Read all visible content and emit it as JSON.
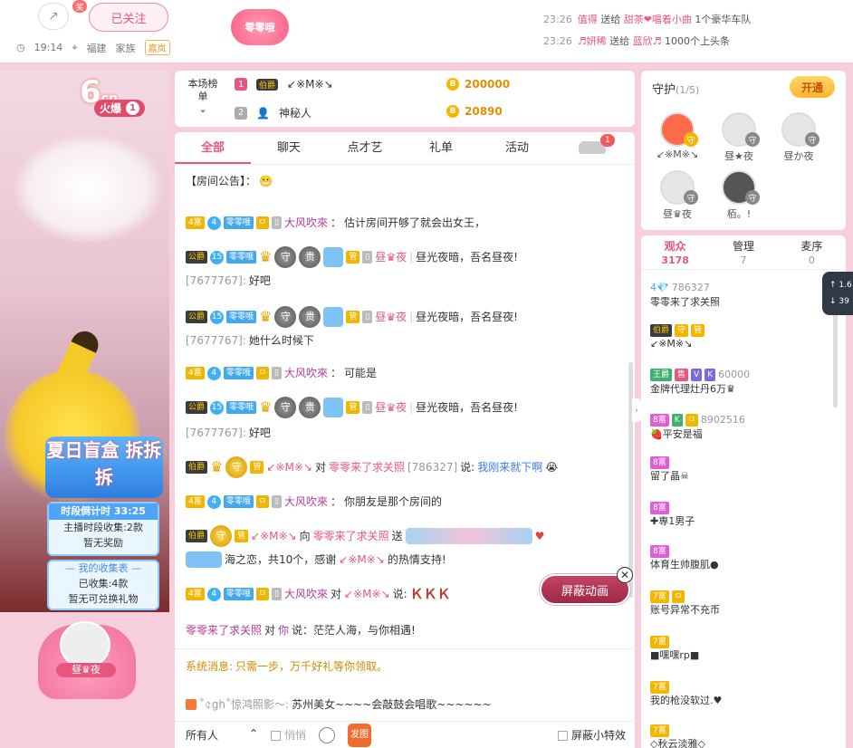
{
  "topbar": {
    "share_badge": "奖",
    "follow_label": "已关注",
    "time": "19:14",
    "location": "福建",
    "family_label": "家族",
    "family_tag": "嘉岚",
    "host_badge": "零零哦",
    "marquee": [
      {
        "time": "23:26",
        "text": "值得",
        "action": "送给",
        "target": "甜茶❤唱着小曲",
        "suffix": "1个豪华车队"
      },
      {
        "time": "23:26",
        "text": "♬妍稀",
        "action": "送给",
        "target": "蓝欣♬",
        "suffix": "1000个上头条"
      }
    ]
  },
  "video": {
    "logo": "6",
    "logo_sub": "cn",
    "hot_label": "火爆",
    "hot_num": "1",
    "box_title": "夏日盲盒 拆拆拆",
    "timer_title": "时段倒计时 33:25",
    "timer_line1": "主播时段收集:2款",
    "timer_line2": "暂无奖励",
    "collect_title": "— 我的收集表 —",
    "collect_line1": "已收集:4款",
    "collect_line2": "暂无可兑换礼物",
    "seat_name": "昼♛夜"
  },
  "rank": {
    "label": "本场榜单",
    "rows": [
      {
        "num": "1",
        "medal": "伯爵",
        "name": "↙※M※↘",
        "coins": "200000"
      },
      {
        "num": "2",
        "medal": "",
        "name": "神秘人",
        "coins": "20890"
      }
    ]
  },
  "chat": {
    "tabs": [
      "全部",
      "聊天",
      "点才艺",
      "礼单",
      "活动"
    ],
    "car_badge": "1",
    "announce": "【房间公告】：",
    "messages": [
      {
        "lv": "4富",
        "circ": "4",
        "fan": "零零哦",
        "name": "大风吹來",
        "sep": "：",
        "text": "估计房间开够了就会出女王，"
      },
      {
        "lv": "公爵",
        "circ": "15",
        "fan": "零零哦",
        "tag": "管",
        "name": "昼♛夜",
        "text": "昼光夜暗，吾名昼夜!"
      },
      {
        "id": "[7677767]:",
        "text": "好吧"
      },
      {
        "lv": "公爵",
        "circ": "15",
        "fan": "零零哦",
        "tag": "管",
        "name": "昼♛夜",
        "text": "昼光夜暗，吾名昼夜!"
      },
      {
        "id": "[7677767]:",
        "text": "她什么时候下"
      },
      {
        "lv": "4富",
        "circ": "4",
        "fan": "零零哦",
        "name": "大风吹來",
        "sep": "：",
        "text": "可能是"
      },
      {
        "lv": "公爵",
        "circ": "15",
        "fan": "零零哦",
        "tag": "管",
        "name": "昼♛夜",
        "text": "昼光夜暗，吾名昼夜!"
      },
      {
        "id": "[7677767]:",
        "text": "好吧"
      },
      {
        "lv": "伯爵",
        "tag": "管",
        "name": "↙※M※↘",
        "mid": "对",
        "target": "零零来了求关照",
        "tid": "[786327]",
        "say": "说:",
        "text": "我刚来就下啊"
      },
      {
        "lv": "4富",
        "circ": "4",
        "fan": "零零哦",
        "name": "大风吹來",
        "sep": "：",
        "text": "你朋友是那个房间的"
      },
      {
        "lv": "伯爵",
        "tag": "管",
        "name": "↙※M※↘",
        "mid": "向",
        "target": "零零来了求关照",
        "say": "送"
      },
      {
        "pre": "海之恋，共10个，感谢",
        "name": "↙※M※↘",
        "text": "的热情支持!"
      },
      {
        "lv": "4富",
        "circ": "4",
        "fan": "零零哦",
        "name": "大风吹來",
        "mid": "对",
        "target": "↙※M※↘",
        "say": "说:",
        "text": "ＫＫＫ"
      }
    ],
    "bottom": {
      "l1_name": "零零来了求关照",
      "l1_mid": "对",
      "l1_target": "你",
      "l1_text": "说：茫茫人海，与你相遇!",
      "sys_label": "系统消息:",
      "sys_text": "只需一步，万千好礼等你领取。",
      "horn_name": "˚৫gh˚惊鸿照影～:",
      "horn_text": "苏州美女~~~~会敲鼓会唱歌~~~~~~"
    },
    "mask_label": "屏蔽动画",
    "input": {
      "target": "所有人",
      "private": "悄悄",
      "gift_label": "发图礼",
      "block_label": "屏蔽小特效"
    }
  },
  "guard": {
    "title": "守护",
    "count": "(1/5)",
    "open": "开通",
    "items": [
      "↙※M※↘",
      "昼★夜",
      "昼か夜",
      "昼♛夜",
      "栢。!"
    ]
  },
  "audience": {
    "tabs": [
      {
        "label": "观众",
        "n": "3178"
      },
      {
        "label": "管理",
        "n": "7"
      },
      {
        "label": "麦序",
        "n": "0"
      }
    ],
    "users": [
      {
        "badges": [
          "4💎"
        ],
        "id": "786327",
        "name": "零零来了求关照"
      },
      {
        "badges": [
          "伯爵",
          "守",
          "管"
        ],
        "id": "",
        "name": "↙※M※↘"
      },
      {
        "badges": [
          "王爵",
          "售",
          "V",
          "K"
        ],
        "id": "60000",
        "name": "金牌代理灶丹6万♛"
      },
      {
        "badges": [
          "8富",
          "K",
          "ㅁ"
        ],
        "id": "8902516",
        "name": "🍓平安是福"
      },
      {
        "badges": [
          "8富"
        ],
        "id": "",
        "name": "留了晶☠"
      },
      {
        "badges": [
          "8富"
        ],
        "id": "",
        "name": "✚専1男子"
      },
      {
        "badges": [
          "8富"
        ],
        "id": "",
        "name": "体育生帅腹肌●"
      },
      {
        "badges": [
          "7富",
          "ㅁ"
        ],
        "id": "",
        "name": "账号异常不充币"
      },
      {
        "badges": [
          "7富"
        ],
        "id": "",
        "name": "■嘿嘿rp■"
      },
      {
        "badges": [
          "7富"
        ],
        "id": "",
        "name": "我的枪没软过.♥"
      },
      {
        "badges": [
          "7富"
        ],
        "id": "",
        "name": "◇秋云淡雅◇"
      }
    ]
  },
  "float": {
    "line1": "↑ 1.6",
    "line2": "↓ 39"
  }
}
